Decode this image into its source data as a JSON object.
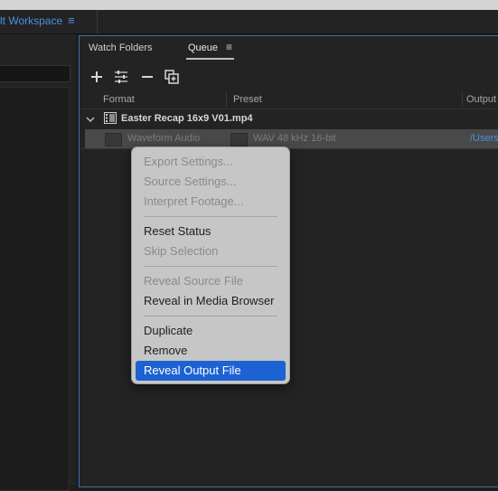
{
  "topbar": {
    "workspace_label": "lt Workspace",
    "menu_icon": "hamburger-menu-icon"
  },
  "queue_panel": {
    "tabs": [
      {
        "label": "Watch Folders"
      },
      {
        "label": "Queue"
      }
    ],
    "tab_menu_icon": "hamburger-menu-icon",
    "toolbar": [
      "add-icon",
      "preset-settings-icon",
      "remove-icon",
      "duplicate-icon"
    ],
    "columns": {
      "format": "Format",
      "preset": "Preset",
      "output": "Output"
    },
    "group": {
      "title": "Easter Recap 16x9 V01.mp4"
    },
    "item": {
      "format": "Waveform Audio",
      "preset": "WAV 48 kHz 16-bit",
      "output": "/Users"
    }
  },
  "context_menu": {
    "items": [
      {
        "label": "Export Settings...",
        "enabled": false
      },
      {
        "label": "Source Settings...",
        "enabled": false
      },
      {
        "label": "Interpret Footage...",
        "enabled": false
      },
      {
        "label": "Reset Status",
        "enabled": true
      },
      {
        "label": "Skip Selection",
        "enabled": false
      },
      {
        "label": "Reveal Source File",
        "enabled": false
      },
      {
        "label": "Reveal in Media Browser",
        "enabled": true
      },
      {
        "label": "Duplicate",
        "enabled": true
      },
      {
        "label": "Remove",
        "enabled": true
      },
      {
        "label": "Reveal Output File",
        "enabled": true,
        "selected": true
      }
    ]
  },
  "colors": {
    "accent": "#4a8fe6",
    "selection": "#1d62d2",
    "panel_border": "#3d6fa8"
  }
}
